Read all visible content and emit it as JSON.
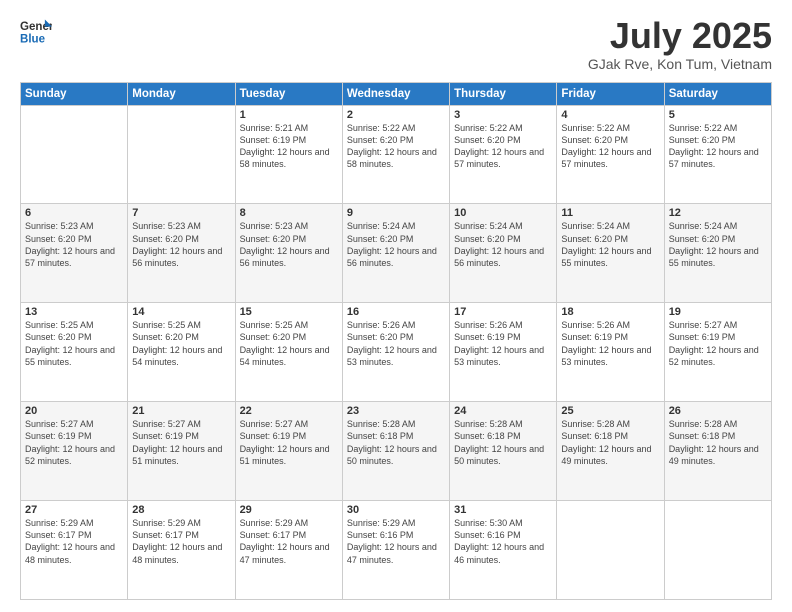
{
  "logo": {
    "line1": "General",
    "line2": "Blue"
  },
  "title": "July 2025",
  "location": "GJak Rve, Kon Tum, Vietnam",
  "days_of_week": [
    "Sunday",
    "Monday",
    "Tuesday",
    "Wednesday",
    "Thursday",
    "Friday",
    "Saturday"
  ],
  "weeks": [
    [
      {
        "day": "",
        "sunrise": "",
        "sunset": "",
        "daylight": ""
      },
      {
        "day": "",
        "sunrise": "",
        "sunset": "",
        "daylight": ""
      },
      {
        "day": "1",
        "sunrise": "Sunrise: 5:21 AM",
        "sunset": "Sunset: 6:19 PM",
        "daylight": "Daylight: 12 hours and 58 minutes."
      },
      {
        "day": "2",
        "sunrise": "Sunrise: 5:22 AM",
        "sunset": "Sunset: 6:20 PM",
        "daylight": "Daylight: 12 hours and 58 minutes."
      },
      {
        "day": "3",
        "sunrise": "Sunrise: 5:22 AM",
        "sunset": "Sunset: 6:20 PM",
        "daylight": "Daylight: 12 hours and 57 minutes."
      },
      {
        "day": "4",
        "sunrise": "Sunrise: 5:22 AM",
        "sunset": "Sunset: 6:20 PM",
        "daylight": "Daylight: 12 hours and 57 minutes."
      },
      {
        "day": "5",
        "sunrise": "Sunrise: 5:22 AM",
        "sunset": "Sunset: 6:20 PM",
        "daylight": "Daylight: 12 hours and 57 minutes."
      }
    ],
    [
      {
        "day": "6",
        "sunrise": "Sunrise: 5:23 AM",
        "sunset": "Sunset: 6:20 PM",
        "daylight": "Daylight: 12 hours and 57 minutes."
      },
      {
        "day": "7",
        "sunrise": "Sunrise: 5:23 AM",
        "sunset": "Sunset: 6:20 PM",
        "daylight": "Daylight: 12 hours and 56 minutes."
      },
      {
        "day": "8",
        "sunrise": "Sunrise: 5:23 AM",
        "sunset": "Sunset: 6:20 PM",
        "daylight": "Daylight: 12 hours and 56 minutes."
      },
      {
        "day": "9",
        "sunrise": "Sunrise: 5:24 AM",
        "sunset": "Sunset: 6:20 PM",
        "daylight": "Daylight: 12 hours and 56 minutes."
      },
      {
        "day": "10",
        "sunrise": "Sunrise: 5:24 AM",
        "sunset": "Sunset: 6:20 PM",
        "daylight": "Daylight: 12 hours and 56 minutes."
      },
      {
        "day": "11",
        "sunrise": "Sunrise: 5:24 AM",
        "sunset": "Sunset: 6:20 PM",
        "daylight": "Daylight: 12 hours and 55 minutes."
      },
      {
        "day": "12",
        "sunrise": "Sunrise: 5:24 AM",
        "sunset": "Sunset: 6:20 PM",
        "daylight": "Daylight: 12 hours and 55 minutes."
      }
    ],
    [
      {
        "day": "13",
        "sunrise": "Sunrise: 5:25 AM",
        "sunset": "Sunset: 6:20 PM",
        "daylight": "Daylight: 12 hours and 55 minutes."
      },
      {
        "day": "14",
        "sunrise": "Sunrise: 5:25 AM",
        "sunset": "Sunset: 6:20 PM",
        "daylight": "Daylight: 12 hours and 54 minutes."
      },
      {
        "day": "15",
        "sunrise": "Sunrise: 5:25 AM",
        "sunset": "Sunset: 6:20 PM",
        "daylight": "Daylight: 12 hours and 54 minutes."
      },
      {
        "day": "16",
        "sunrise": "Sunrise: 5:26 AM",
        "sunset": "Sunset: 6:20 PM",
        "daylight": "Daylight: 12 hours and 53 minutes."
      },
      {
        "day": "17",
        "sunrise": "Sunrise: 5:26 AM",
        "sunset": "Sunset: 6:19 PM",
        "daylight": "Daylight: 12 hours and 53 minutes."
      },
      {
        "day": "18",
        "sunrise": "Sunrise: 5:26 AM",
        "sunset": "Sunset: 6:19 PM",
        "daylight": "Daylight: 12 hours and 53 minutes."
      },
      {
        "day": "19",
        "sunrise": "Sunrise: 5:27 AM",
        "sunset": "Sunset: 6:19 PM",
        "daylight": "Daylight: 12 hours and 52 minutes."
      }
    ],
    [
      {
        "day": "20",
        "sunrise": "Sunrise: 5:27 AM",
        "sunset": "Sunset: 6:19 PM",
        "daylight": "Daylight: 12 hours and 52 minutes."
      },
      {
        "day": "21",
        "sunrise": "Sunrise: 5:27 AM",
        "sunset": "Sunset: 6:19 PM",
        "daylight": "Daylight: 12 hours and 51 minutes."
      },
      {
        "day": "22",
        "sunrise": "Sunrise: 5:27 AM",
        "sunset": "Sunset: 6:19 PM",
        "daylight": "Daylight: 12 hours and 51 minutes."
      },
      {
        "day": "23",
        "sunrise": "Sunrise: 5:28 AM",
        "sunset": "Sunset: 6:18 PM",
        "daylight": "Daylight: 12 hours and 50 minutes."
      },
      {
        "day": "24",
        "sunrise": "Sunrise: 5:28 AM",
        "sunset": "Sunset: 6:18 PM",
        "daylight": "Daylight: 12 hours and 50 minutes."
      },
      {
        "day": "25",
        "sunrise": "Sunrise: 5:28 AM",
        "sunset": "Sunset: 6:18 PM",
        "daylight": "Daylight: 12 hours and 49 minutes."
      },
      {
        "day": "26",
        "sunrise": "Sunrise: 5:28 AM",
        "sunset": "Sunset: 6:18 PM",
        "daylight": "Daylight: 12 hours and 49 minutes."
      }
    ],
    [
      {
        "day": "27",
        "sunrise": "Sunrise: 5:29 AM",
        "sunset": "Sunset: 6:17 PM",
        "daylight": "Daylight: 12 hours and 48 minutes."
      },
      {
        "day": "28",
        "sunrise": "Sunrise: 5:29 AM",
        "sunset": "Sunset: 6:17 PM",
        "daylight": "Daylight: 12 hours and 48 minutes."
      },
      {
        "day": "29",
        "sunrise": "Sunrise: 5:29 AM",
        "sunset": "Sunset: 6:17 PM",
        "daylight": "Daylight: 12 hours and 47 minutes."
      },
      {
        "day": "30",
        "sunrise": "Sunrise: 5:29 AM",
        "sunset": "Sunset: 6:16 PM",
        "daylight": "Daylight: 12 hours and 47 minutes."
      },
      {
        "day": "31",
        "sunrise": "Sunrise: 5:30 AM",
        "sunset": "Sunset: 6:16 PM",
        "daylight": "Daylight: 12 hours and 46 minutes."
      },
      {
        "day": "",
        "sunrise": "",
        "sunset": "",
        "daylight": ""
      },
      {
        "day": "",
        "sunrise": "",
        "sunset": "",
        "daylight": ""
      }
    ]
  ]
}
